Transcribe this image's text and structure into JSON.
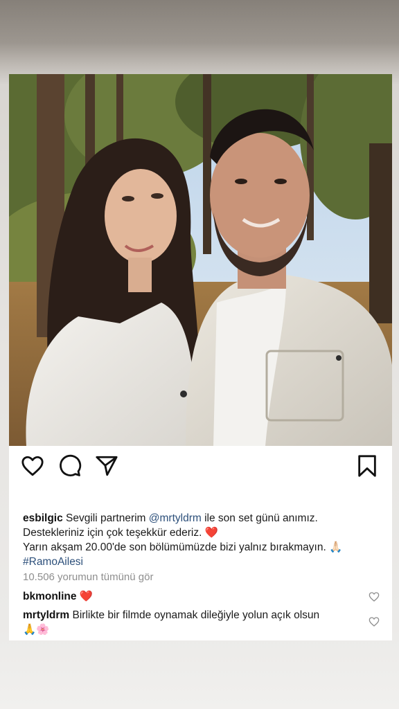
{
  "post": {
    "photo_alt": "selfie",
    "caption": {
      "username": "esbilgic",
      "text_part1": "Sevgili partnerim",
      "mention": "@mrtyldrm",
      "text_part2": "ile son set günü anımız. Desteklerin iz için çok teşekkür ederiz.",
      "text_line1_rest": "ile son set günü anımız.",
      "text_line2": "Destekleriniz için çok teşekkür ederiz.",
      "heart_emoji": "❤️",
      "text_line3": "Yarın akşam 20.00'de son bölümümüzde bizi yalnız bırakmayın.",
      "pray_emoji": "🙏🏻",
      "hashtag": "#RamoAilesi"
    },
    "view_comments": "10.506 yorumun tümünü gör",
    "comments": [
      {
        "username": "bkmonline",
        "text": "",
        "emoji": "❤️"
      },
      {
        "username": "mrtyldrm",
        "text": "Birlikte bir filmde oynamak dileğiyle yolun açık olsun",
        "emoji": "🙏🌸"
      }
    ]
  },
  "icons": {
    "like": "heart-icon",
    "comment": "comment-icon",
    "share": "send-icon",
    "save": "bookmark-icon"
  },
  "colors": {
    "link": "#2c4f7a",
    "muted": "#8e8e8e",
    "text": "#1a1a1a"
  }
}
